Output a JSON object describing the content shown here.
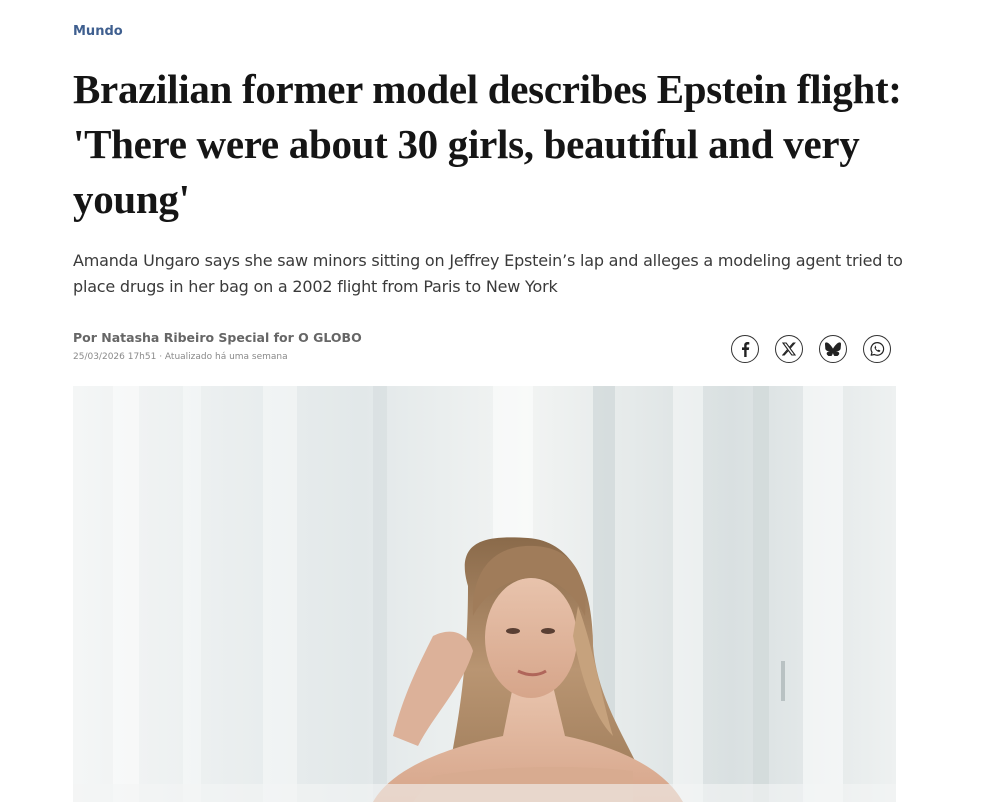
{
  "article": {
    "section": "Mundo",
    "headline": "Brazilian former model describes Epstein flight: 'There were about 30 girls, beautiful and very young'",
    "subtitle": "Amanda Ungaro says she saw minors sitting on Jeffrey Epstein’s lap and alleges a modeling agent tried to place drugs in her bag on a 2002 flight from Paris to New York",
    "byline": "Por Natasha Ribeiro Special for O GLOBO",
    "dateline": "25/03/2026 17h51 · Atualizado há uma semana"
  },
  "share": {
    "icons": [
      "facebook-icon",
      "x-icon",
      "bluesky-icon",
      "whatsapp-icon"
    ]
  },
  "colors": {
    "section": "#3f5f8f",
    "headline": "#151515",
    "subtitle": "#3a3a3a"
  }
}
